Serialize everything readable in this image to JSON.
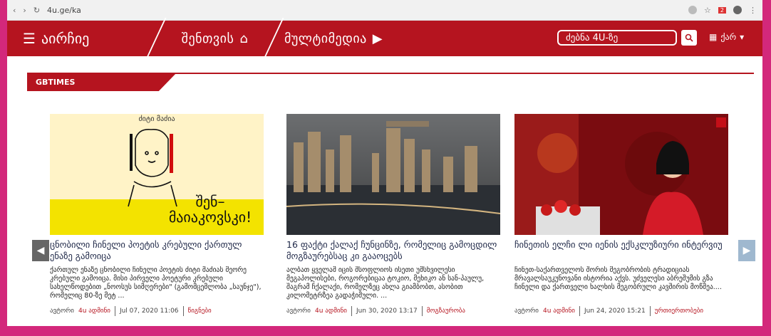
{
  "browser": {
    "url": "4u.ge/ka",
    "notification_count": "2"
  },
  "nav": {
    "menu_label": "აირჩიე",
    "home_label": "შენთვის",
    "multimedia_label": "მულტიმედია",
    "search_placeholder": "ძებნა 4U-ზე",
    "lang_label": "ქარ"
  },
  "section": {
    "title": "GBTIMES"
  },
  "cards": [
    {
      "image_text_top": "ძიტი მაძია",
      "image_text_main": "შენ– მაიაკოვსკი!",
      "title": "ცნობილი ჩინელი პოეტის კრებული ქართულ ენაზე გამოიცა",
      "excerpt": "ქართულ ენაზე ცნობილი ჩინელი პოეტის ძიტი მაძიას მეორე კრებული გამოიცა. მისი პირველი პოეტური კრებული სახელწოდებით „ნოოსუს სიმღერები\" (გამომცემლობა „საუნჯე\"), რომელიც 80-ზე მეტ ...",
      "author_prefix": "ავტორი",
      "author": "4u ადმინი",
      "date": "Jul 07, 2020 11:06",
      "category": "წიგნები"
    },
    {
      "title": "16 ფაქტი ქალაქ ჩუნცინზე, რომელიც გამოცდილ მოგზაურებსაც კი გააოცებს",
      "excerpt": "ალბათ ყველამ იცის შსოფლიოს ისეთი უმსხვილესი მეგაპოლისები, როგორებიცაა ტოკიო, მეხიკო ან სან-პაულუ, შაგრამ ჩქალაქი, რომელზეც ახლა გიამბობთ, ასობით კილომეტრზეა გადაჭიმული. ...",
      "author_prefix": "ავტორი",
      "author": "4u ადმინი",
      "date": "Jun 30, 2020 13:17",
      "category": "მოგზაურობა"
    },
    {
      "title": "ჩინეთის ელჩი ლი იენის ექსკლუზიური ინტერვიუ",
      "excerpt": "ჩინეთ-საქართველოს შორის მეგობრობის ტრადიციას მრავალსაუკუნოვანი ისტორია აქვს. უძველესი აბრეშუმის გზა ჩინელი და ქართველი ხალხის მეგობრული კავშირის მოწმეა....",
      "author_prefix": "ავტორი",
      "author": "4u ადმინი",
      "date": "Jun 24, 2020 15:21",
      "category": "ურთიერთობები"
    }
  ],
  "colors": {
    "brand": "#b5141f",
    "title": "#1e2747",
    "outer": "#d3287b"
  }
}
